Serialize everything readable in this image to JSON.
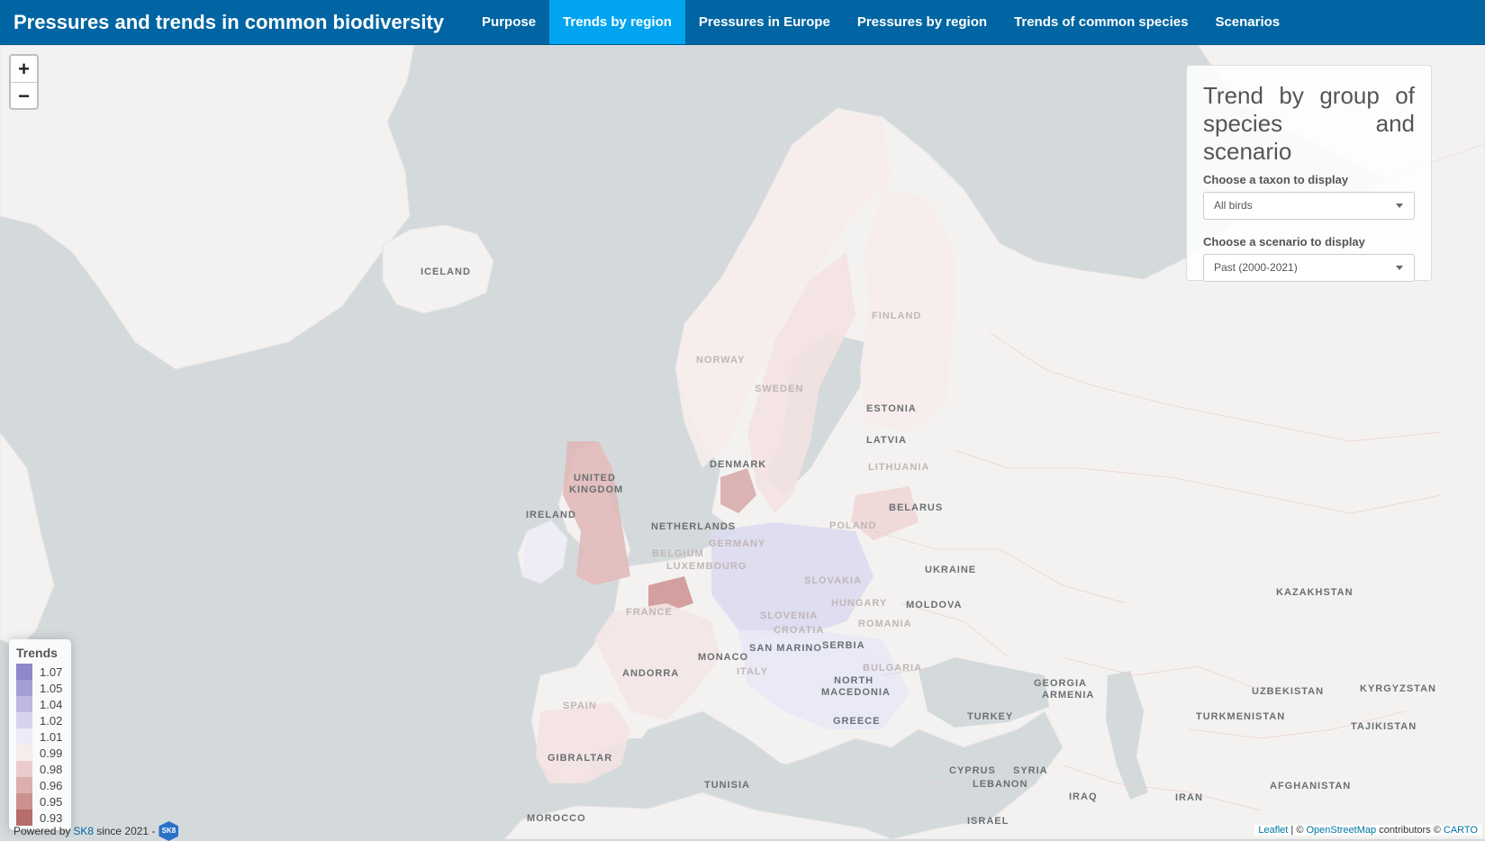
{
  "navbar": {
    "brand": "Pressures and trends in common biodiversity",
    "items": [
      {
        "label": "Purpose",
        "active": false
      },
      {
        "label": "Trends by region",
        "active": true
      },
      {
        "label": "Pressures in Europe",
        "active": false
      },
      {
        "label": "Pressures by region",
        "active": false
      },
      {
        "label": "Trends of common species",
        "active": false
      },
      {
        "label": "Scenarios",
        "active": false
      }
    ]
  },
  "zoom": {
    "in_label": "+",
    "out_label": "−"
  },
  "panel": {
    "title": "Trend by group of species and scenario",
    "taxon_label": "Choose a taxon to display",
    "taxon_value": "All birds",
    "scenario_label": "Choose a scenario to display",
    "scenario_value": "Past (2000-2021)"
  },
  "legend": {
    "title": "Trends",
    "entries": [
      {
        "value": "1.07",
        "color": "#8d88c8"
      },
      {
        "value": "1.05",
        "color": "#a39fd4"
      },
      {
        "value": "1.04",
        "color": "#bcb8e0"
      },
      {
        "value": "1.02",
        "color": "#d6d3ec"
      },
      {
        "value": "1.01",
        "color": "#ecebf7"
      },
      {
        "value": "0.99",
        "color": "#f7ecec"
      },
      {
        "value": "0.98",
        "color": "#eacccc"
      },
      {
        "value": "0.96",
        "color": "#dcaeae"
      },
      {
        "value": "0.95",
        "color": "#cc9090"
      },
      {
        "value": "0.93",
        "color": "#b66c6c"
      }
    ]
  },
  "map_labels": [
    "ICELAND",
    "NORWAY",
    "SWEDEN",
    "FINLAND",
    "ESTONIA",
    "LATVIA",
    "LITHUANIA",
    "DENMARK",
    "UNITED",
    "KINGDOM",
    "IRELAND",
    "NETHERLANDS",
    "BELGIUM",
    "LUXEMBOURG",
    "GERMANY",
    "POLAND",
    "BELARUS",
    "UKRAINE",
    "MOLDOVA",
    "SLOVAKIA",
    "HUNGARY",
    "ROMANIA",
    "FRANCE",
    "SLOVENIA",
    "CROATIA",
    "SERBIA",
    "MONACO",
    "SAN MARINO",
    "ANDORRA",
    "SPAIN",
    "ITALY",
    "BULGARIA",
    "NORTH",
    "MACEDONIA",
    "GREECE",
    "TURKEY",
    "GEORGIA",
    "ARMENIA",
    "KAZAKHSTAN",
    "UZBEKISTAN",
    "KYRGYZSTAN",
    "TURKMENISTAN",
    "TAJIKISTAN",
    "AFGHANISTAN",
    "IRAN",
    "IRAQ",
    "SYRIA",
    "CYPRUS",
    "LEBANON",
    "ISRAEL",
    "GIBRALTAR",
    "TUNISIA",
    "MOROCCO"
  ],
  "footer": {
    "powered_prefix": "Powered by",
    "sk8_link": "SK8",
    "powered_suffix": "since 2021 -",
    "badge": "SK8",
    "attribution": {
      "leaflet": "Leaflet",
      "sep1": " | © ",
      "osm": "OpenStreetMap",
      "contrib": " contributors © ",
      "carto": "CARTO"
    }
  }
}
